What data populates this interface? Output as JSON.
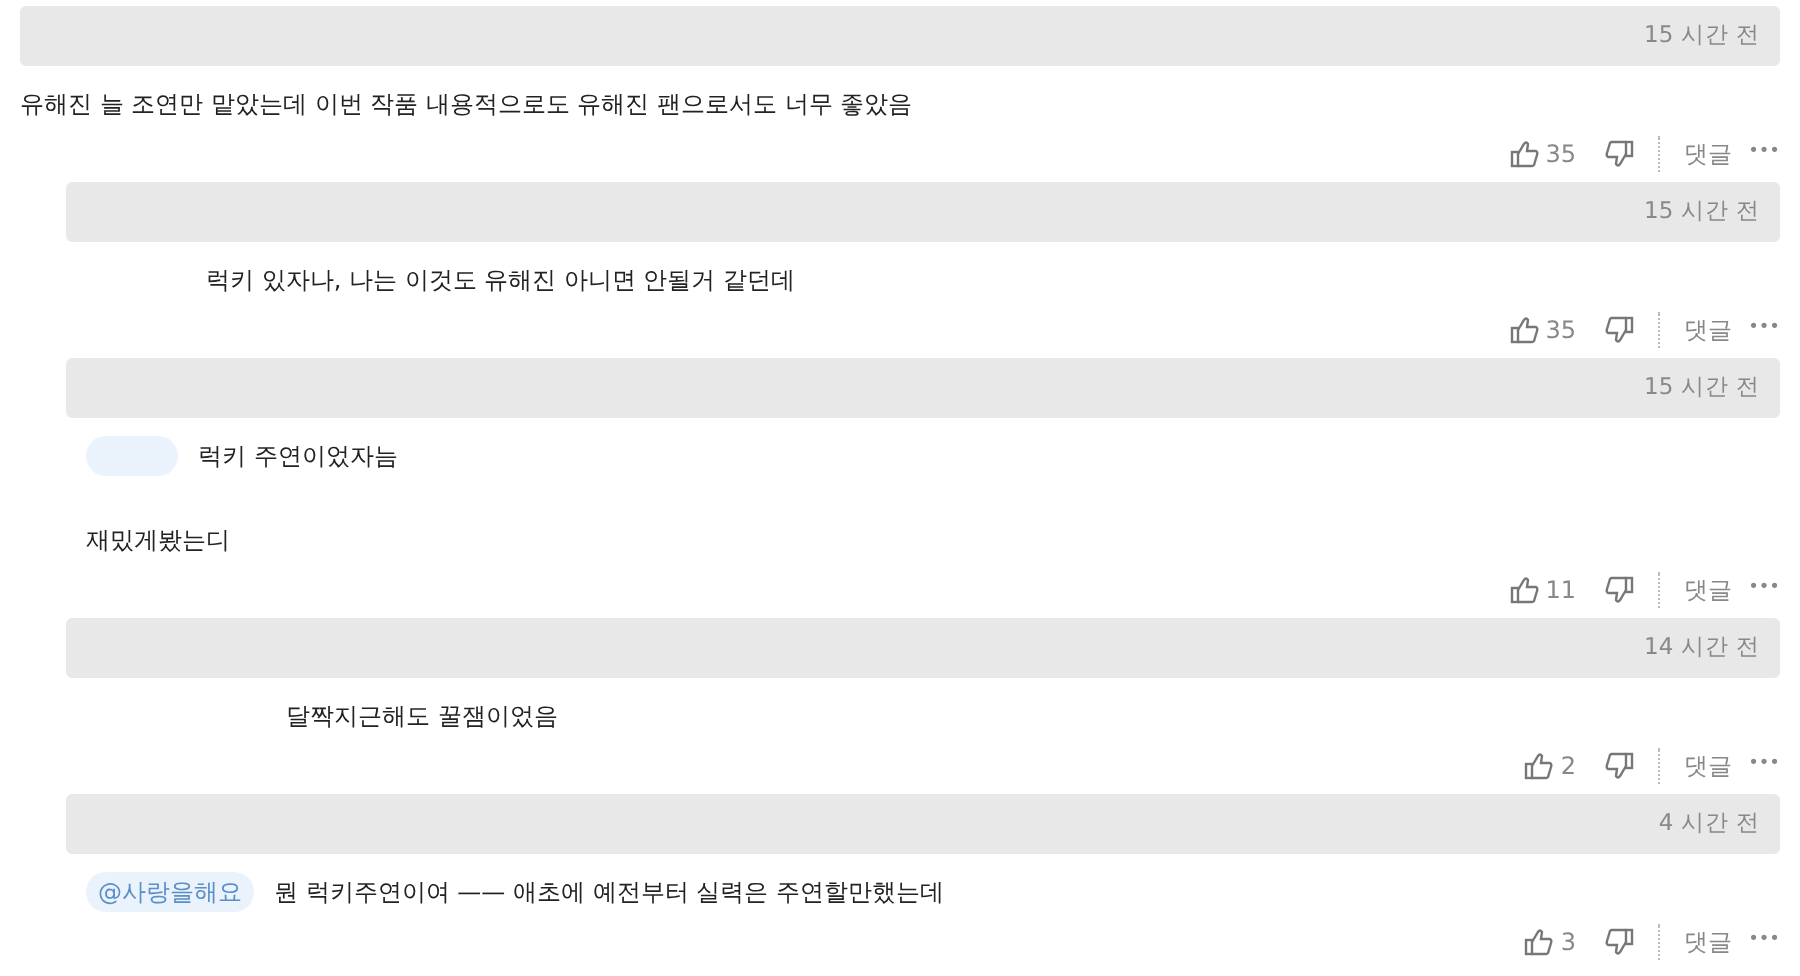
{
  "comments": [
    {
      "kind": "top",
      "time": "15 시간 전",
      "lines": [
        "유해진 늘 조연만 맡았는데 이번 작품 내용적으로도 유해진 팬으로서도 너무 좋았음"
      ],
      "likes": "35",
      "reply_label": "댓글",
      "more": "•••"
    },
    {
      "kind": "reply",
      "time": "15 시간 전",
      "mention": {
        "kind": "hidden"
      },
      "lines": [
        "럭키 있자나, 나는 이것도 유해진 아니면 안될거 같던데"
      ],
      "likes": "35",
      "reply_label": "댓글",
      "more": "•••"
    },
    {
      "kind": "reply",
      "time": "15 시간 전",
      "mention": {
        "kind": "blank"
      },
      "lines": [
        "럭키 주연이었자늠",
        "재밌게봤는디"
      ],
      "likes": "11",
      "reply_label": "댓글",
      "more": "•••"
    },
    {
      "kind": "reply",
      "time": "14 시간 전",
      "mention": {
        "kind": "wide"
      },
      "lines": [
        "달짝지근해도 꿀잼이었음"
      ],
      "likes": "2",
      "reply_label": "댓글",
      "more": "•••"
    },
    {
      "kind": "reply",
      "time": "4 시간 전",
      "mention": {
        "kind": "text",
        "text": "@사랑을해요"
      },
      "lines": [
        "뭔 럭키주연이여 —— 애초에 예전부터 실력은 주연할만했는데"
      ],
      "likes": "3",
      "reply_label": "댓글",
      "more": "•••"
    }
  ]
}
